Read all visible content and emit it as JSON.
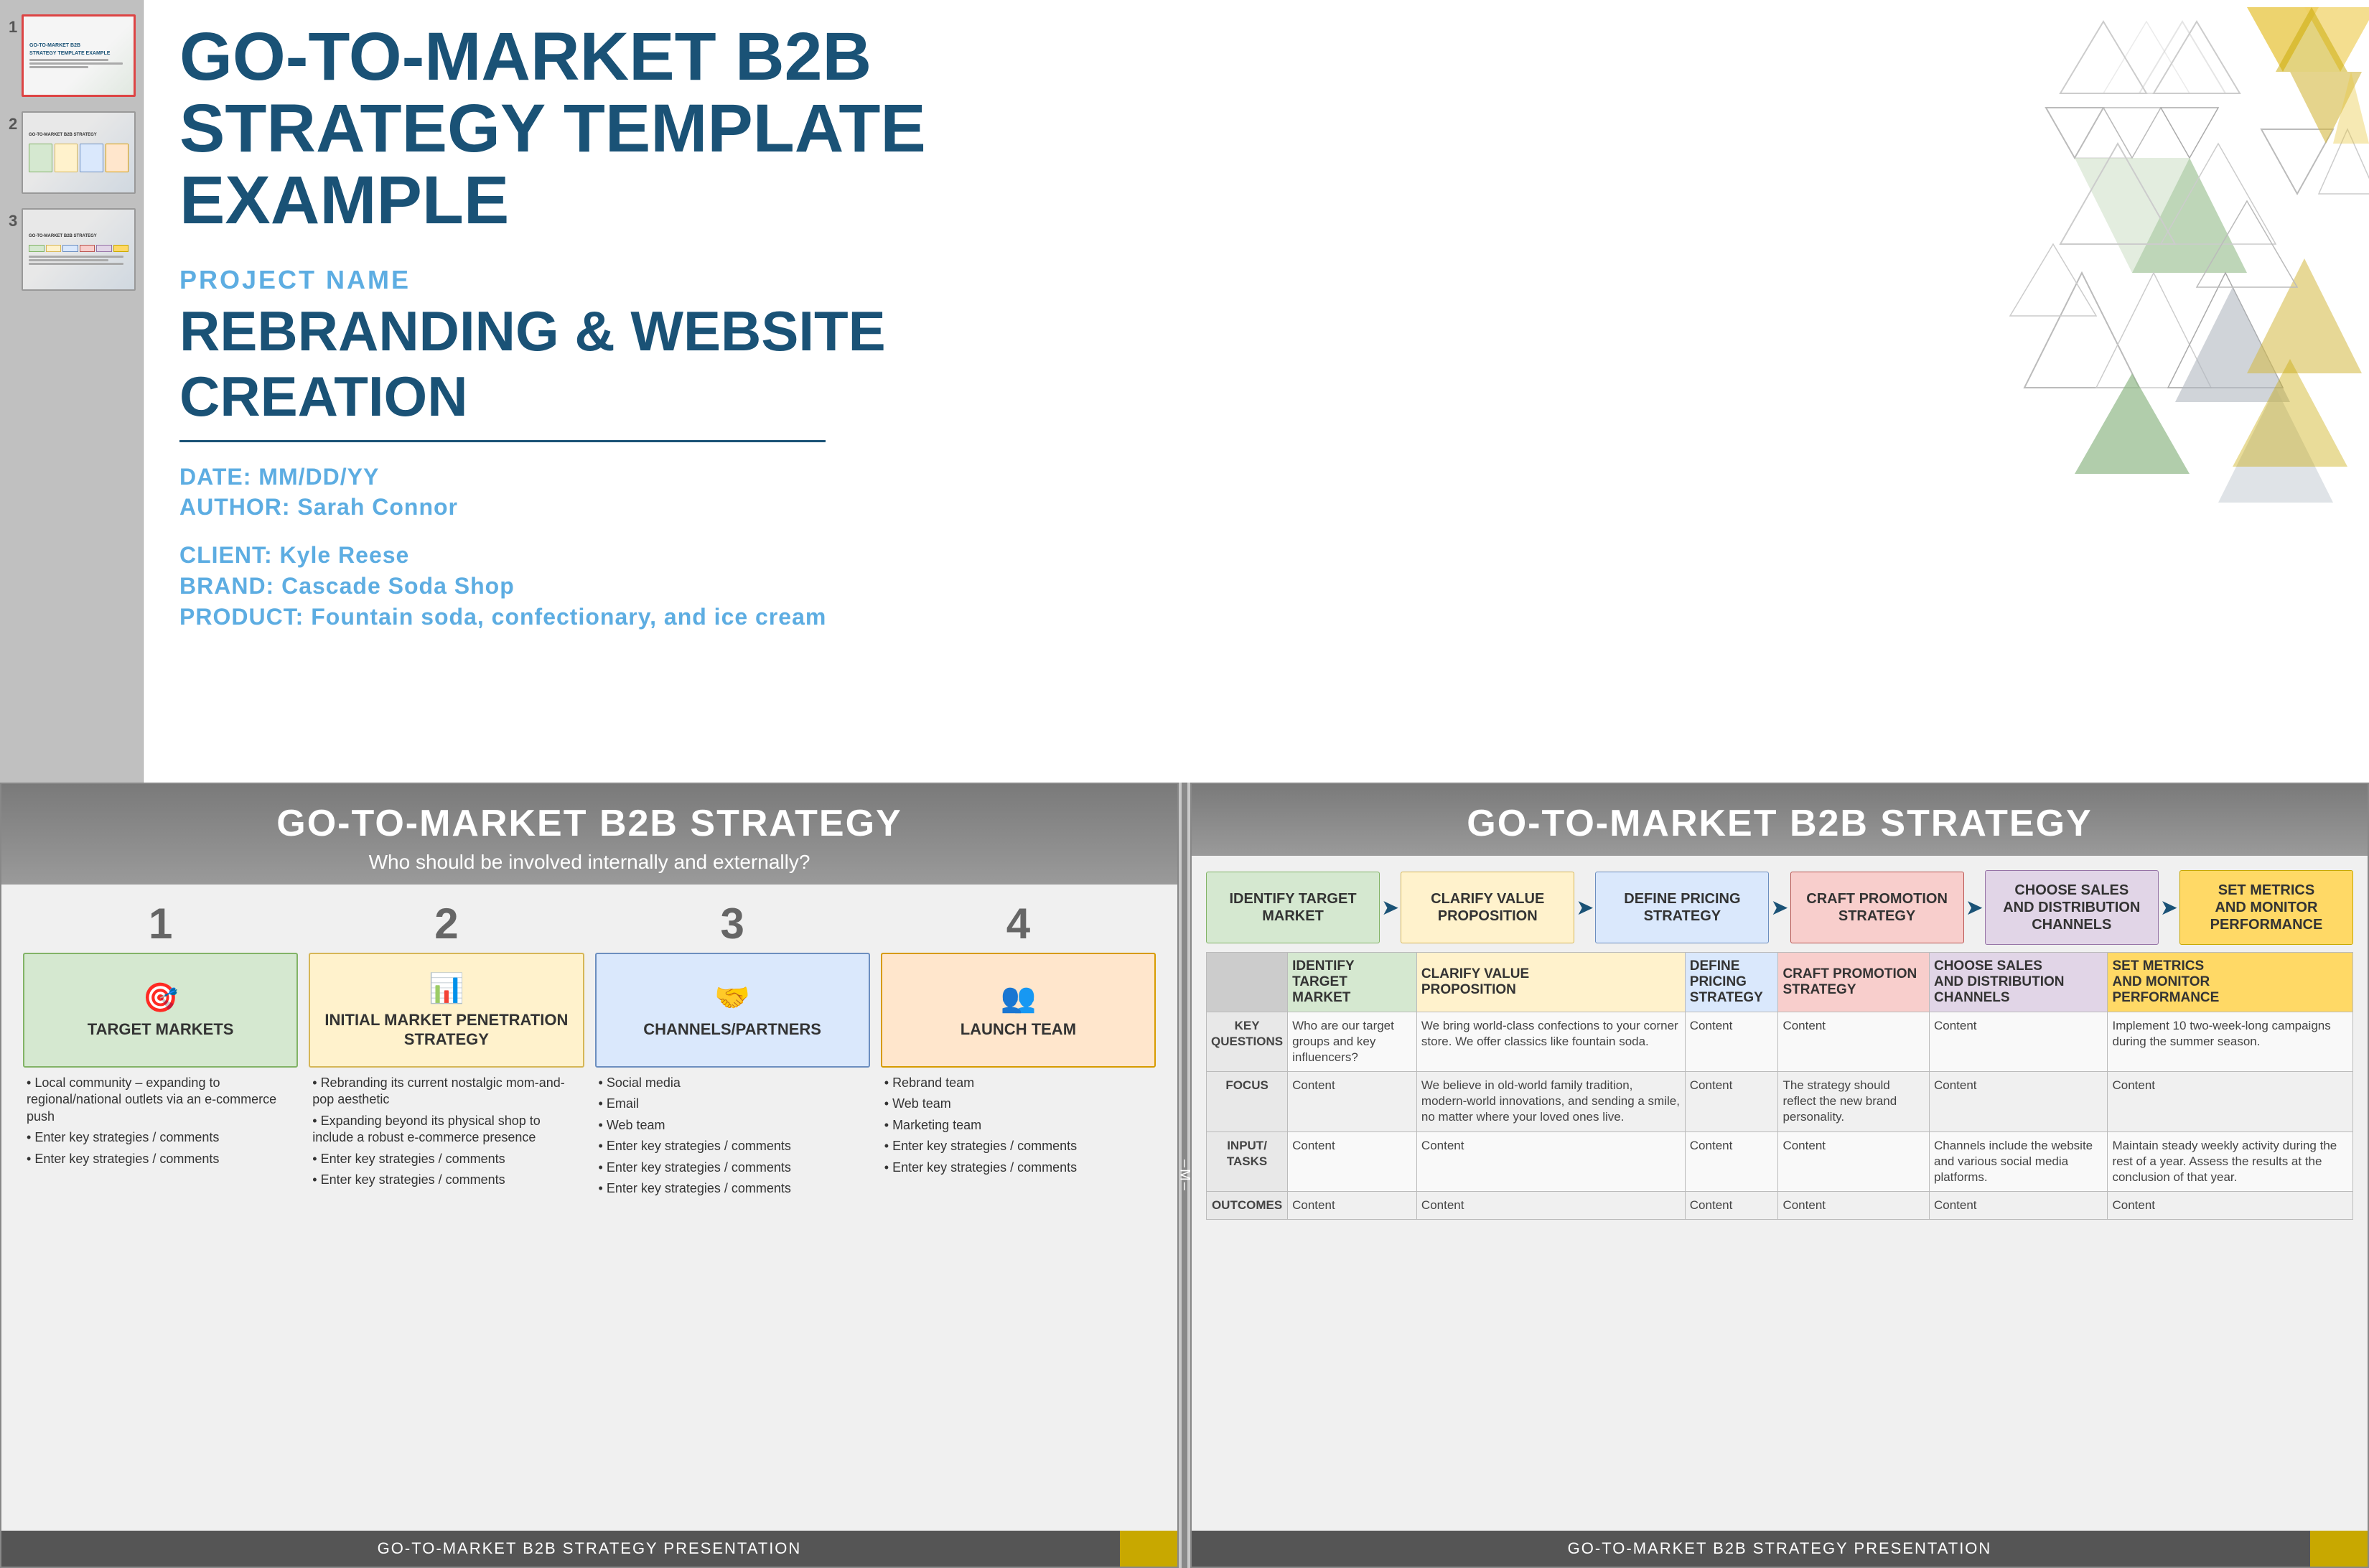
{
  "sidebar": {
    "slides": [
      {
        "number": "1",
        "active": true,
        "title": "GO-TO-MARKET B2B\nSTRATEGY TEMPLATE"
      },
      {
        "number": "2",
        "active": false,
        "title": "GO-TO-MARKET B2B STRATEGY"
      },
      {
        "number": "3",
        "active": false,
        "title": "GO-TO-MARKET B2B STRATEGY"
      }
    ]
  },
  "slide1": {
    "main_title_line1": "GO-TO-MARKET B2B",
    "main_title_line2": "STRATEGY TEMPLATE EXAMPLE",
    "project_label": "PROJECT NAME",
    "project_name": "REBRANDING & WEBSITE CREATION",
    "date_label": "DATE: MM/DD/YY",
    "author_label": "AUTHOR: Sarah Connor",
    "client_label": "CLIENT: Kyle Reese",
    "brand_label": "BRAND: Cascade Soda Shop",
    "product_label": "PRODUCT: Fountain soda, confectionary, and ice cream"
  },
  "slide2": {
    "title": "GO-TO-MARKET B2B STRATEGY",
    "subtitle": "Who should be involved internally and externally?",
    "columns": [
      {
        "number": "1",
        "icon": "🎯",
        "label": "TARGET MARKETS",
        "box_color": "green-box",
        "bullets": [
          "Local community – expanding to regional/national outlets via an e-commerce push",
          "Enter key strategies / comments",
          "Enter key strategies / comments"
        ]
      },
      {
        "number": "2",
        "icon": "📊",
        "label": "INITIAL MARKET PENETRATION STRATEGY",
        "box_color": "yellow-box",
        "bullets": [
          "Rebranding its current nostalgic mom-and-pop aesthetic",
          "Expanding beyond its physical shop to include a robust e-commerce presence",
          "Enter key strategies / comments",
          "Enter key strategies / comments"
        ]
      },
      {
        "number": "3",
        "icon": "🤝",
        "label": "CHANNELS/PARTNERS",
        "box_color": "blue-box",
        "bullets": [
          "Social media",
          "Email",
          "Web team",
          "Enter key strategies / comments",
          "Enter key strategies / comments",
          "Enter key strategies / comments"
        ]
      },
      {
        "number": "4",
        "icon": "👥",
        "label": "LAUNCH TEAM",
        "box_color": "salmon-box",
        "bullets": [
          "Rebrand team",
          "Web team",
          "Marketing team",
          "Enter key strategies / comments",
          "Enter key strategies / comments"
        ]
      }
    ],
    "footer": "GO-TO-MARKET B2B STRATEGY PRESENTATION"
  },
  "slide3": {
    "title": "GO-TO-MARKET B2B STRATEGY",
    "flow_steps": [
      {
        "label": "IDENTIFY TARGET\nMARKET",
        "color": "s1"
      },
      {
        "label": "CLARIFY VALUE\nPROPOSITION",
        "color": "s2"
      },
      {
        "label": "DEFINE PRICING\nSTRATEGY",
        "color": "s3"
      },
      {
        "label": "CRAFT PROMOTION\nSTRATEGY",
        "color": "s4"
      },
      {
        "label": "CHOOSE SALES\nAND DISTRIBUTION\nCHANNELS",
        "color": "s5"
      },
      {
        "label": "SET METRICS\nAND MONITOR\nPERFORMANCE",
        "color": "s6"
      }
    ],
    "table": {
      "row_headers": [
        "KEY\nQUESTIONS",
        "FOCUS",
        "INPUT/\nTASKS",
        "OUTCOMES"
      ],
      "col1": {
        "kq": "Who are our target groups and key influencers?",
        "focus": "Content",
        "tasks": "Content",
        "outcomes": "Content"
      },
      "col2": {
        "kq": "We bring world-class confections to your corner store. We offer classics like fountain soda.",
        "focus": "We believe in old-world family tradition, modern-world innovations, and sending a smile, no matter where your loved ones live.",
        "tasks": "Content",
        "outcomes": "Content"
      },
      "col3": {
        "kq": "Content",
        "focus": "Content",
        "tasks": "Content",
        "outcomes": "Content"
      },
      "col4": {
        "kq": "Content",
        "focus": "The strategy should reflect the new brand personality.",
        "tasks": "Content",
        "outcomes": "Content"
      },
      "col5": {
        "kq": "Content",
        "focus": "Content",
        "tasks": "Channels include the website and various social media platforms.",
        "outcomes": "Content"
      },
      "col6": {
        "kq": "Implement 10 two-week-long campaigns during the summer season.",
        "focus": "Content",
        "tasks": "Maintain steady weekly activity during the rest of a year. Assess the results at the conclusion of that year.",
        "outcomes": "Content"
      }
    },
    "footer": "GO-TO-MARKET B2B STRATEGY PRESENTATION"
  }
}
